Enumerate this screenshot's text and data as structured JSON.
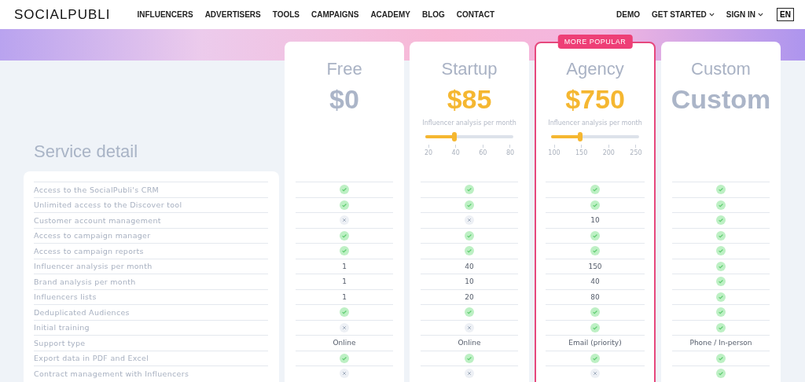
{
  "header": {
    "logo": "SOCIALPUBLI",
    "nav": [
      {
        "label": "INFLUENCERS",
        "has_menu": false
      },
      {
        "label": "ADVERTISERS",
        "has_menu": false
      },
      {
        "label": "TOOLS",
        "has_menu": false
      },
      {
        "label": "CAMPAIGNS",
        "has_menu": false
      },
      {
        "label": "ACADEMY",
        "has_menu": false
      },
      {
        "label": "BLOG",
        "has_menu": false
      },
      {
        "label": "CONTACT",
        "has_menu": false
      }
    ],
    "right_nav": [
      {
        "label": "DEMO",
        "has_menu": false
      },
      {
        "label": "GET STARTED",
        "has_menu": true
      },
      {
        "label": "SIGN IN",
        "has_menu": true
      }
    ],
    "language": "EN"
  },
  "section_title": "Service detail",
  "features": [
    "Access to the SocialPubli's CRM",
    "Unlimited access to the Discover tool",
    "Customer account management",
    "Access to campaign manager",
    "Access to campaign reports",
    "Influencer analysis per month",
    "Brand analysis per month",
    "Influencers lists",
    "Deduplicated Audiences",
    "Initial training",
    "Support type",
    "Export data in PDF and Excel",
    "Contract management with Influencers"
  ],
  "plans": [
    {
      "name": "Free",
      "price": "$0",
      "price_highlighted": false,
      "featured": false,
      "cells": [
        {
          "kind": "check"
        },
        {
          "kind": "check"
        },
        {
          "kind": "cross"
        },
        {
          "kind": "check"
        },
        {
          "kind": "check"
        },
        {
          "kind": "text",
          "text": "1"
        },
        {
          "kind": "text",
          "text": "1"
        },
        {
          "kind": "text",
          "text": "1"
        },
        {
          "kind": "check"
        },
        {
          "kind": "cross"
        },
        {
          "kind": "text",
          "text": "Online"
        },
        {
          "kind": "check"
        },
        {
          "kind": "cross"
        }
      ]
    },
    {
      "name": "Startup",
      "price": "$85",
      "price_highlighted": true,
      "featured": false,
      "slider": {
        "label": "Influencer analysis per month",
        "level": 0.33,
        "ticks": [
          "20",
          "40",
          "60",
          "80"
        ]
      },
      "cells": [
        {
          "kind": "check"
        },
        {
          "kind": "check"
        },
        {
          "kind": "cross"
        },
        {
          "kind": "check"
        },
        {
          "kind": "check"
        },
        {
          "kind": "text",
          "text": "40"
        },
        {
          "kind": "text",
          "text": "10"
        },
        {
          "kind": "text",
          "text": "20"
        },
        {
          "kind": "check"
        },
        {
          "kind": "cross"
        },
        {
          "kind": "text",
          "text": "Online"
        },
        {
          "kind": "check"
        },
        {
          "kind": "cross"
        }
      ]
    },
    {
      "name": "Agency",
      "price": "$750",
      "price_highlighted": true,
      "featured": true,
      "badge": "MORE POPULAR",
      "slider": {
        "label": "Influencer analysis per month",
        "level": 0.33,
        "ticks": [
          "100",
          "150",
          "200",
          "250"
        ]
      },
      "cells": [
        {
          "kind": "check"
        },
        {
          "kind": "check"
        },
        {
          "kind": "text",
          "text": "10"
        },
        {
          "kind": "check"
        },
        {
          "kind": "check"
        },
        {
          "kind": "text",
          "text": "150"
        },
        {
          "kind": "text",
          "text": "40"
        },
        {
          "kind": "text",
          "text": "80"
        },
        {
          "kind": "check"
        },
        {
          "kind": "check"
        },
        {
          "kind": "text",
          "text": "Email (priority)"
        },
        {
          "kind": "check"
        },
        {
          "kind": "cross"
        }
      ]
    },
    {
      "name": "Custom",
      "price": "Custom",
      "price_highlighted": false,
      "featured": false,
      "cells": [
        {
          "kind": "check"
        },
        {
          "kind": "check"
        },
        {
          "kind": "check"
        },
        {
          "kind": "check"
        },
        {
          "kind": "check"
        },
        {
          "kind": "check"
        },
        {
          "kind": "check"
        },
        {
          "kind": "check"
        },
        {
          "kind": "check"
        },
        {
          "kind": "check"
        },
        {
          "kind": "text",
          "text": "Phone / In-person"
        },
        {
          "kind": "check"
        },
        {
          "kind": "check"
        }
      ]
    }
  ]
}
